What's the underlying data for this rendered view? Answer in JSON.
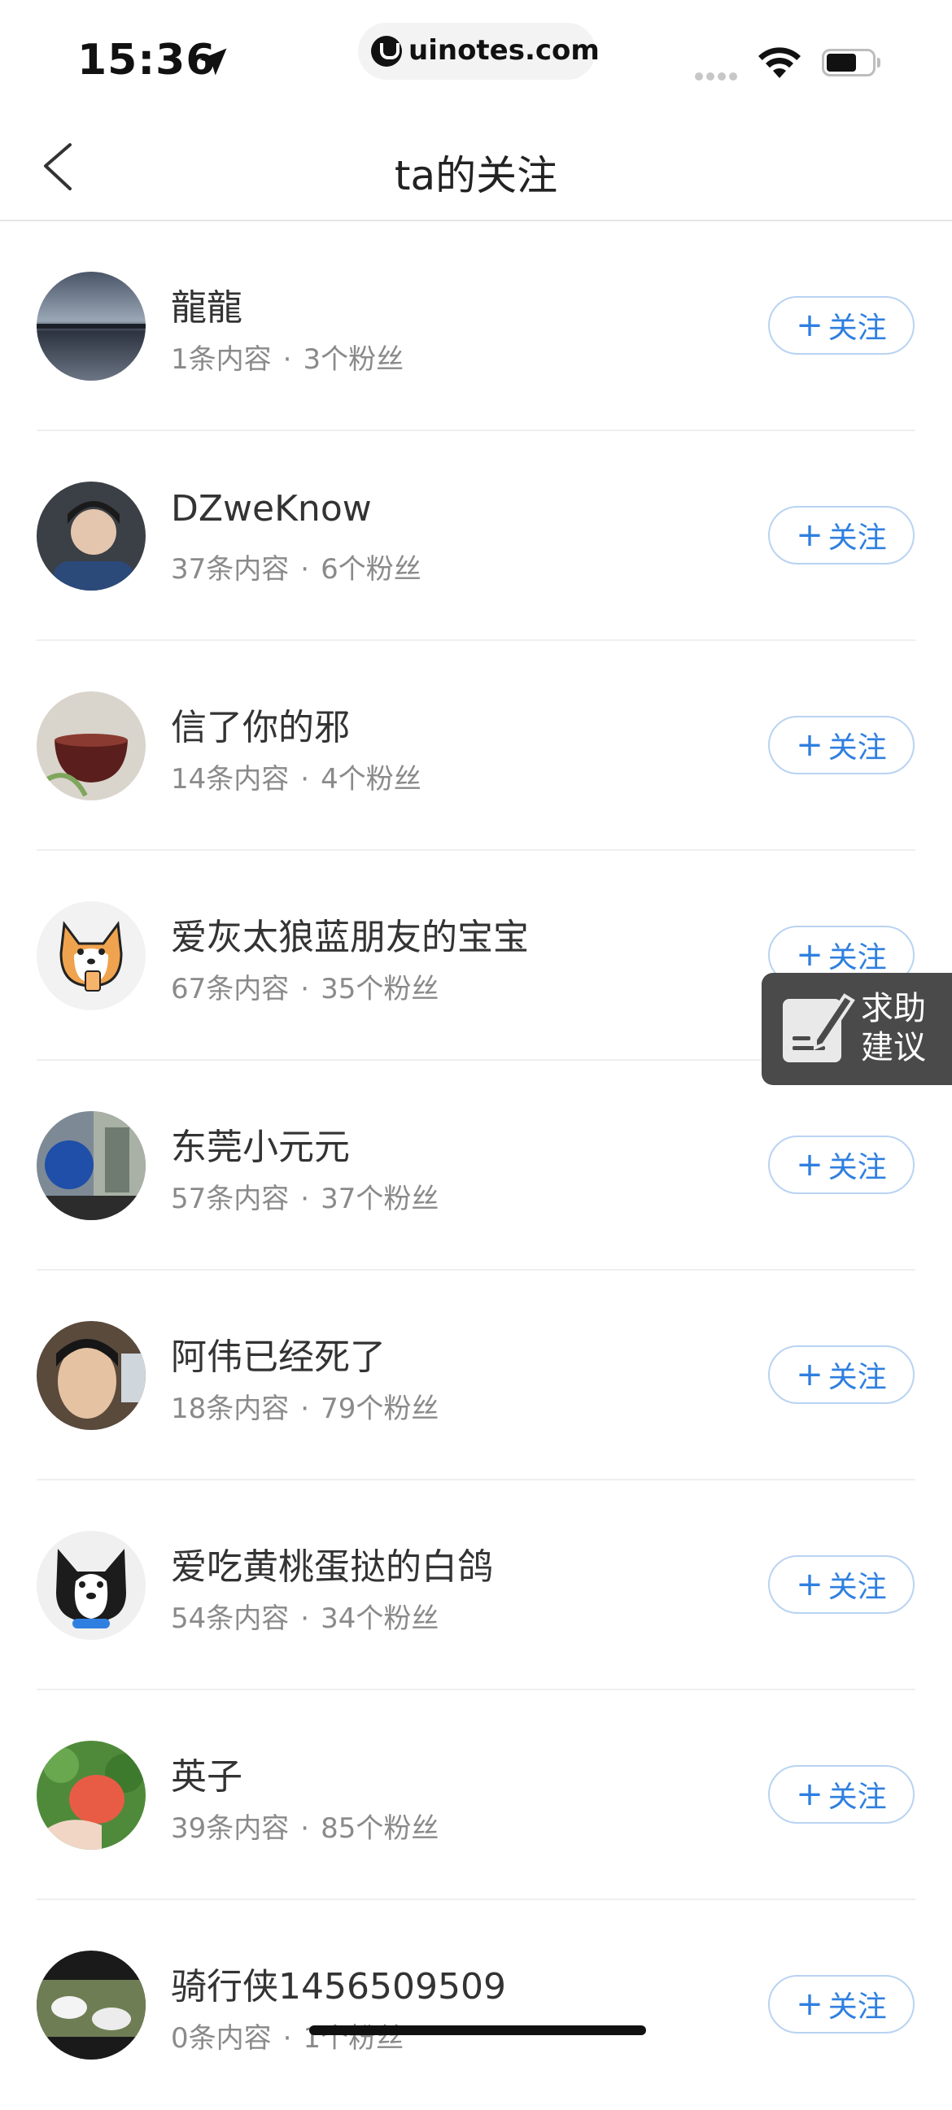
{
  "status_bar": {
    "time": "15:36",
    "url": "uinotes.com",
    "icons": [
      "location-arrow-icon",
      "site-logo-icon",
      "cellular-signal-icon",
      "wifi-icon",
      "battery-icon"
    ]
  },
  "nav": {
    "title": "ta的关注",
    "back_icon": "chevron-left-icon"
  },
  "follow_button_label": "关注",
  "follow_button_plus": "+",
  "meta_separator": "·",
  "accent_color": "#2f7fe0",
  "users": [
    {
      "name": "龍龍",
      "posts": "1条内容",
      "fans": "3个粉丝"
    },
    {
      "name": "DZweKnow",
      "posts": "37条内容",
      "fans": "6个粉丝"
    },
    {
      "name": "信了你的邪",
      "posts": "14条内容",
      "fans": "4个粉丝"
    },
    {
      "name": "爱灰太狼蓝朋友的宝宝",
      "posts": "67条内容",
      "fans": "35个粉丝"
    },
    {
      "name": "东莞小元元",
      "posts": "57条内容",
      "fans": "37个粉丝"
    },
    {
      "name": "阿伟已经死了",
      "posts": "18条内容",
      "fans": "79个粉丝"
    },
    {
      "name": "爱吃黄桃蛋挞的白鸽",
      "posts": "54条内容",
      "fans": "34个粉丝"
    },
    {
      "name": "英子",
      "posts": "39条内容",
      "fans": "85个粉丝"
    },
    {
      "name": "骑行侠1456509509",
      "posts": "0条内容",
      "fans": "1个粉丝"
    }
  ],
  "help_float": {
    "line1": "求助",
    "line2": "建议"
  }
}
